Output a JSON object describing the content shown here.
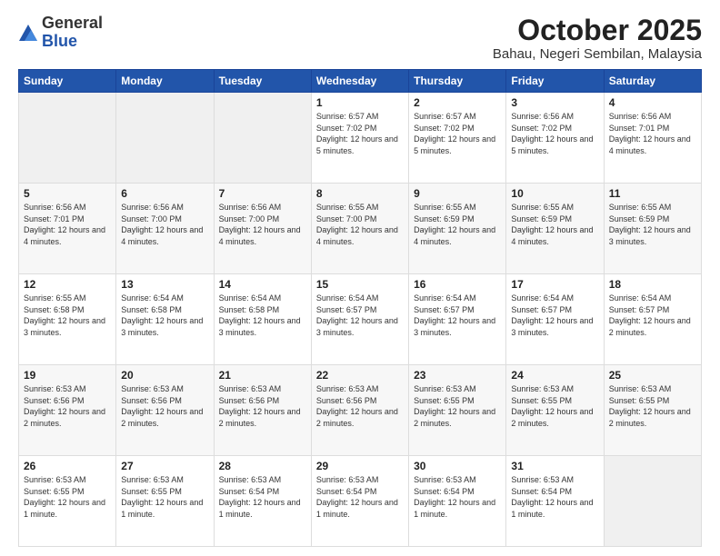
{
  "logo": {
    "general": "General",
    "blue": "Blue"
  },
  "header": {
    "month_title": "October 2025",
    "location": "Bahau, Negeri Sembilan, Malaysia"
  },
  "days_of_week": [
    "Sunday",
    "Monday",
    "Tuesday",
    "Wednesday",
    "Thursday",
    "Friday",
    "Saturday"
  ],
  "weeks": [
    [
      {
        "day": "",
        "content": ""
      },
      {
        "day": "",
        "content": ""
      },
      {
        "day": "",
        "content": ""
      },
      {
        "day": "1",
        "content": "Sunrise: 6:57 AM\nSunset: 7:02 PM\nDaylight: 12 hours\nand 5 minutes."
      },
      {
        "day": "2",
        "content": "Sunrise: 6:57 AM\nSunset: 7:02 PM\nDaylight: 12 hours\nand 5 minutes."
      },
      {
        "day": "3",
        "content": "Sunrise: 6:56 AM\nSunset: 7:02 PM\nDaylight: 12 hours\nand 5 minutes."
      },
      {
        "day": "4",
        "content": "Sunrise: 6:56 AM\nSunset: 7:01 PM\nDaylight: 12 hours\nand 4 minutes."
      }
    ],
    [
      {
        "day": "5",
        "content": "Sunrise: 6:56 AM\nSunset: 7:01 PM\nDaylight: 12 hours\nand 4 minutes."
      },
      {
        "day": "6",
        "content": "Sunrise: 6:56 AM\nSunset: 7:00 PM\nDaylight: 12 hours\nand 4 minutes."
      },
      {
        "day": "7",
        "content": "Sunrise: 6:56 AM\nSunset: 7:00 PM\nDaylight: 12 hours\nand 4 minutes."
      },
      {
        "day": "8",
        "content": "Sunrise: 6:55 AM\nSunset: 7:00 PM\nDaylight: 12 hours\nand 4 minutes."
      },
      {
        "day": "9",
        "content": "Sunrise: 6:55 AM\nSunset: 6:59 PM\nDaylight: 12 hours\nand 4 minutes."
      },
      {
        "day": "10",
        "content": "Sunrise: 6:55 AM\nSunset: 6:59 PM\nDaylight: 12 hours\nand 4 minutes."
      },
      {
        "day": "11",
        "content": "Sunrise: 6:55 AM\nSunset: 6:59 PM\nDaylight: 12 hours\nand 3 minutes."
      }
    ],
    [
      {
        "day": "12",
        "content": "Sunrise: 6:55 AM\nSunset: 6:58 PM\nDaylight: 12 hours\nand 3 minutes."
      },
      {
        "day": "13",
        "content": "Sunrise: 6:54 AM\nSunset: 6:58 PM\nDaylight: 12 hours\nand 3 minutes."
      },
      {
        "day": "14",
        "content": "Sunrise: 6:54 AM\nSunset: 6:58 PM\nDaylight: 12 hours\nand 3 minutes."
      },
      {
        "day": "15",
        "content": "Sunrise: 6:54 AM\nSunset: 6:57 PM\nDaylight: 12 hours\nand 3 minutes."
      },
      {
        "day": "16",
        "content": "Sunrise: 6:54 AM\nSunset: 6:57 PM\nDaylight: 12 hours\nand 3 minutes."
      },
      {
        "day": "17",
        "content": "Sunrise: 6:54 AM\nSunset: 6:57 PM\nDaylight: 12 hours\nand 3 minutes."
      },
      {
        "day": "18",
        "content": "Sunrise: 6:54 AM\nSunset: 6:57 PM\nDaylight: 12 hours\nand 2 minutes."
      }
    ],
    [
      {
        "day": "19",
        "content": "Sunrise: 6:53 AM\nSunset: 6:56 PM\nDaylight: 12 hours\nand 2 minutes."
      },
      {
        "day": "20",
        "content": "Sunrise: 6:53 AM\nSunset: 6:56 PM\nDaylight: 12 hours\nand 2 minutes."
      },
      {
        "day": "21",
        "content": "Sunrise: 6:53 AM\nSunset: 6:56 PM\nDaylight: 12 hours\nand 2 minutes."
      },
      {
        "day": "22",
        "content": "Sunrise: 6:53 AM\nSunset: 6:56 PM\nDaylight: 12 hours\nand 2 minutes."
      },
      {
        "day": "23",
        "content": "Sunrise: 6:53 AM\nSunset: 6:55 PM\nDaylight: 12 hours\nand 2 minutes."
      },
      {
        "day": "24",
        "content": "Sunrise: 6:53 AM\nSunset: 6:55 PM\nDaylight: 12 hours\nand 2 minutes."
      },
      {
        "day": "25",
        "content": "Sunrise: 6:53 AM\nSunset: 6:55 PM\nDaylight: 12 hours\nand 2 minutes."
      }
    ],
    [
      {
        "day": "26",
        "content": "Sunrise: 6:53 AM\nSunset: 6:55 PM\nDaylight: 12 hours\nand 1 minute."
      },
      {
        "day": "27",
        "content": "Sunrise: 6:53 AM\nSunset: 6:55 PM\nDaylight: 12 hours\nand 1 minute."
      },
      {
        "day": "28",
        "content": "Sunrise: 6:53 AM\nSunset: 6:54 PM\nDaylight: 12 hours\nand 1 minute."
      },
      {
        "day": "29",
        "content": "Sunrise: 6:53 AM\nSunset: 6:54 PM\nDaylight: 12 hours\nand 1 minute."
      },
      {
        "day": "30",
        "content": "Sunrise: 6:53 AM\nSunset: 6:54 PM\nDaylight: 12 hours\nand 1 minute."
      },
      {
        "day": "31",
        "content": "Sunrise: 6:53 AM\nSunset: 6:54 PM\nDaylight: 12 hours\nand 1 minute."
      },
      {
        "day": "",
        "content": ""
      }
    ]
  ]
}
